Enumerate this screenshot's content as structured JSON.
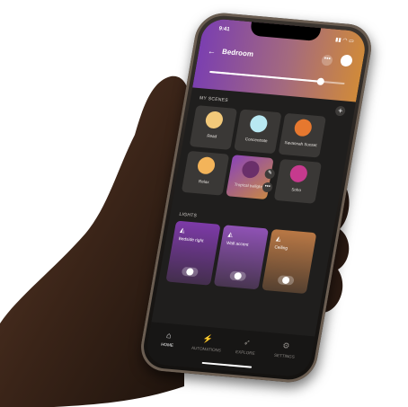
{
  "status": {
    "time": "9:41",
    "icons": "▮▮ ◠ ▭"
  },
  "header": {
    "back_icon": "arrow-left-icon",
    "title": "Bedroom",
    "more_label": "•••",
    "brightness_percent": 82,
    "gradient": [
      "#7b3fb0",
      "#a46a7e",
      "#d08a3a"
    ]
  },
  "scenes": {
    "section_label": "MY SCENES",
    "add_label": "+",
    "items": [
      {
        "label": "Read",
        "color": "#f2c97a",
        "active": false
      },
      {
        "label": "Concentrate",
        "color": "#b8e8f2",
        "active": false
      },
      {
        "label": "Savannah Sunset",
        "color": "#e6782f",
        "active": false
      },
      {
        "label": "Relax",
        "color": "#f3b45a",
        "active": false
      },
      {
        "label": "Tropical twilight",
        "color": "#6a2f6a",
        "active": true
      },
      {
        "label": "Soho",
        "color": "#c63a8e",
        "active": false
      }
    ],
    "edit_label": "✎",
    "more_label": "•••"
  },
  "lights": {
    "section_label": "LIGHTS",
    "items": [
      {
        "label": "Bedside right",
        "color": "#7d3aa8"
      },
      {
        "label": "Wall accent",
        "color": "#8f52b5"
      },
      {
        "label": "Ceiling",
        "color": "#b97845"
      }
    ]
  },
  "tabs": [
    {
      "label": "HOME",
      "icon": "home-icon",
      "glyph": "⌂",
      "active": true
    },
    {
      "label": "AUTOMATIONS",
      "icon": "lightning-icon",
      "glyph": "⚡",
      "active": false
    },
    {
      "label": "EXPLORE",
      "icon": "rocket-icon",
      "glyph": "➶",
      "active": false
    },
    {
      "label": "SETTINGS",
      "icon": "gear-icon",
      "glyph": "⚙",
      "active": false
    }
  ]
}
